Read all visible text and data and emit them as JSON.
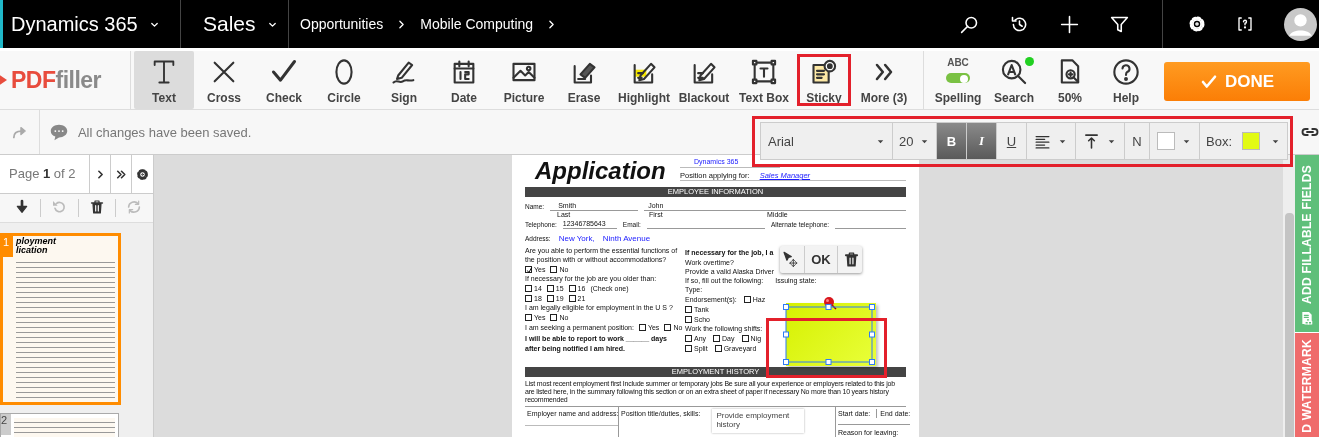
{
  "top_bar": {
    "app_name": "Dynamics 365",
    "area": "Sales",
    "breadcrumbs": [
      "Opportunities",
      "Mobile Computing"
    ]
  },
  "editor": {
    "logo": [
      "PDF",
      "filler"
    ],
    "tools": [
      {
        "kind": "text",
        "label": "Text",
        "selected": true,
        "highlighted": false
      },
      {
        "kind": "cross",
        "label": "Cross",
        "selected": false,
        "highlighted": false
      },
      {
        "kind": "check",
        "label": "Check",
        "selected": false,
        "highlighted": false
      },
      {
        "kind": "circle",
        "label": "Circle",
        "selected": false,
        "highlighted": false
      },
      {
        "kind": "sign",
        "label": "Sign",
        "selected": false,
        "highlighted": false
      },
      {
        "kind": "date",
        "label": "Date",
        "selected": false,
        "highlighted": false
      },
      {
        "kind": "picture",
        "label": "Picture",
        "selected": false,
        "highlighted": false
      },
      {
        "kind": "erase",
        "label": "Erase",
        "selected": false,
        "highlighted": false
      },
      {
        "kind": "highlight",
        "label": "Highlight",
        "selected": false,
        "highlighted": false
      },
      {
        "kind": "blackout",
        "label": "Blackout",
        "selected": false,
        "highlighted": false
      },
      {
        "kind": "textbox",
        "label": "Text Box",
        "selected": false,
        "highlighted": false
      },
      {
        "kind": "sticky",
        "label": "Sticky",
        "selected": false,
        "highlighted": true
      },
      {
        "kind": "more",
        "label": "More (3)",
        "selected": false,
        "highlighted": false
      }
    ],
    "right_tools": [
      {
        "kind": "spelling",
        "label": "Spelling",
        "badge": "ABC",
        "on": true,
        "notification": false
      },
      {
        "kind": "search",
        "label": "Search",
        "notification": true
      },
      {
        "kind": "zoom",
        "label": "50%",
        "notification": false
      },
      {
        "kind": "help",
        "label": "Help",
        "notification": false
      }
    ],
    "done_button": "DONE",
    "status": "All changes have been saved.",
    "format_bar": {
      "highlighted": true,
      "font": "Arial",
      "size": "20",
      "bold_label": "B",
      "bold": true,
      "italic_label": "I",
      "italic": true,
      "underline_label": "U",
      "underline": false,
      "normal_label": "N",
      "swatches": [
        {
          "kind": "text",
          "color": "#ffffff"
        },
        {
          "kind": "box",
          "label": "Box:",
          "color": "#e2fa14"
        }
      ]
    }
  },
  "pages_panel": {
    "page_label": "Page **1** of 2",
    "page_tools": [
      {
        "kind": "download",
        "disabled": false
      },
      {
        "kind": "undo",
        "disabled": true
      },
      {
        "kind": "delete",
        "disabled": false
      },
      {
        "kind": "rotate",
        "disabled": true
      }
    ],
    "thumbnails": [
      {
        "number": "1",
        "selected": true,
        "title_lines": [
          "ployment",
          "lication"
        ]
      },
      {
        "number": "2",
        "selected": false
      }
    ]
  },
  "document": {
    "title": "Application",
    "company": "Dynamics 365",
    "position_label": "Position applying for:",
    "position_value": "Sales Manager",
    "employee_section": "EMPLOYEE INFORMATION",
    "name_label": "Name:",
    "last_name": "Smith",
    "first_name": "John",
    "name_captions": [
      "Last",
      "First",
      "Middle"
    ],
    "telephone_label": "Telephone:",
    "telephone": "12346785643",
    "email_label": "Email:",
    "alt_phone_label": "Alternate telephone:",
    "address_label": "Address:",
    "address": [
      "New York,",
      "Ninth Avenue"
    ],
    "left_questions": [
      {
        "kind": "question",
        "text": "Are you able to perform the essential functions of the position with or without accommodations?"
      },
      {
        "kind": "options",
        "options": [
          {
            "label": "Yes",
            "checked": true
          },
          {
            "label": "No",
            "checked": false
          }
        ]
      },
      {
        "kind": "question",
        "text": "If necessary for the job are you older than:"
      },
      {
        "kind": "options",
        "options": [
          {
            "label": "14",
            "checked": false
          },
          {
            "label": "15",
            "checked": false
          },
          {
            "label": "16",
            "checked": false
          }
        ],
        "note": "(Check one)"
      },
      {
        "kind": "options",
        "options": [
          {
            "label": "18",
            "checked": false
          },
          {
            "label": "19",
            "checked": false
          },
          {
            "label": "21",
            "checked": false
          }
        ]
      },
      {
        "kind": "question",
        "text": "I am legally eligible for employment in the U S ?"
      },
      {
        "kind": "options",
        "options": [
          {
            "label": "Yes",
            "checked": false
          },
          {
            "label": "No",
            "checked": false
          }
        ]
      },
      {
        "kind": "options",
        "text": "I am seeking a permanent position:",
        "options": [
          {
            "label": "Yes",
            "checked": false
          },
          {
            "label": "No",
            "checked": false
          }
        ]
      },
      {
        "kind": "statement",
        "text": "I will be able to report to work ______ days after being notified I am hired."
      }
    ],
    "right_questions": [
      {
        "kind": "statement",
        "text": "If necessary for the job, I a"
      },
      {
        "kind": "question",
        "text": "Work overtime?"
      },
      {
        "kind": "question",
        "text": "Provide a valid Alaska Driver"
      },
      {
        "kind": "question",
        "text": "If so, fill out the following:",
        "note": "Issuing state:"
      },
      {
        "kind": "question",
        "text": "Type:"
      },
      {
        "kind": "options",
        "text": "Endorsement(s):",
        "options": [
          {
            "label": "Haz",
            "checked": false
          }
        ]
      },
      {
        "kind": "options",
        "options": [
          {
            "label": "Tank",
            "checked": false
          }
        ]
      },
      {
        "kind": "options",
        "options": [
          {
            "label": "Scho",
            "checked": false
          }
        ]
      },
      {
        "kind": "question",
        "text": "Work the following shifts:"
      },
      {
        "kind": "options",
        "options": [
          {
            "label": "Any",
            "checked": false
          },
          {
            "label": "Day",
            "checked": false
          },
          {
            "label": "Nig",
            "checked": false
          }
        ]
      },
      {
        "kind": "options",
        "options": [
          {
            "label": "Split",
            "checked": false
          },
          {
            "label": "Graveyard",
            "checked": false
          }
        ]
      }
    ],
    "history_section": "EMPLOYMENT HISTORY",
    "history_note": "List most recent employment first  Include summer or temporary jobs  Be sure all your experience or employers related to this job are listed here, in the summary following this section or on an extra sheet of paper if necessary  No more than 10 years history recommended",
    "history_columns": [
      "Employer name and address:",
      "Position title/duties, skills:",
      "Start date:",
      "End date:"
    ],
    "history_input": "Provide employment history",
    "reason_label": "Reason for leaving:",
    "edit_popup": {
      "ok_label": "OK"
    },
    "sticky_note": {
      "selected": true,
      "highlighted": true
    }
  },
  "side_tabs": [
    {
      "kind": "fillable",
      "label": "ADD FILLABLE FIELDS",
      "color": "#5fbf7a"
    },
    {
      "kind": "watermark",
      "label": "D WATERMARK",
      "color": "#ef6b6b"
    }
  ]
}
